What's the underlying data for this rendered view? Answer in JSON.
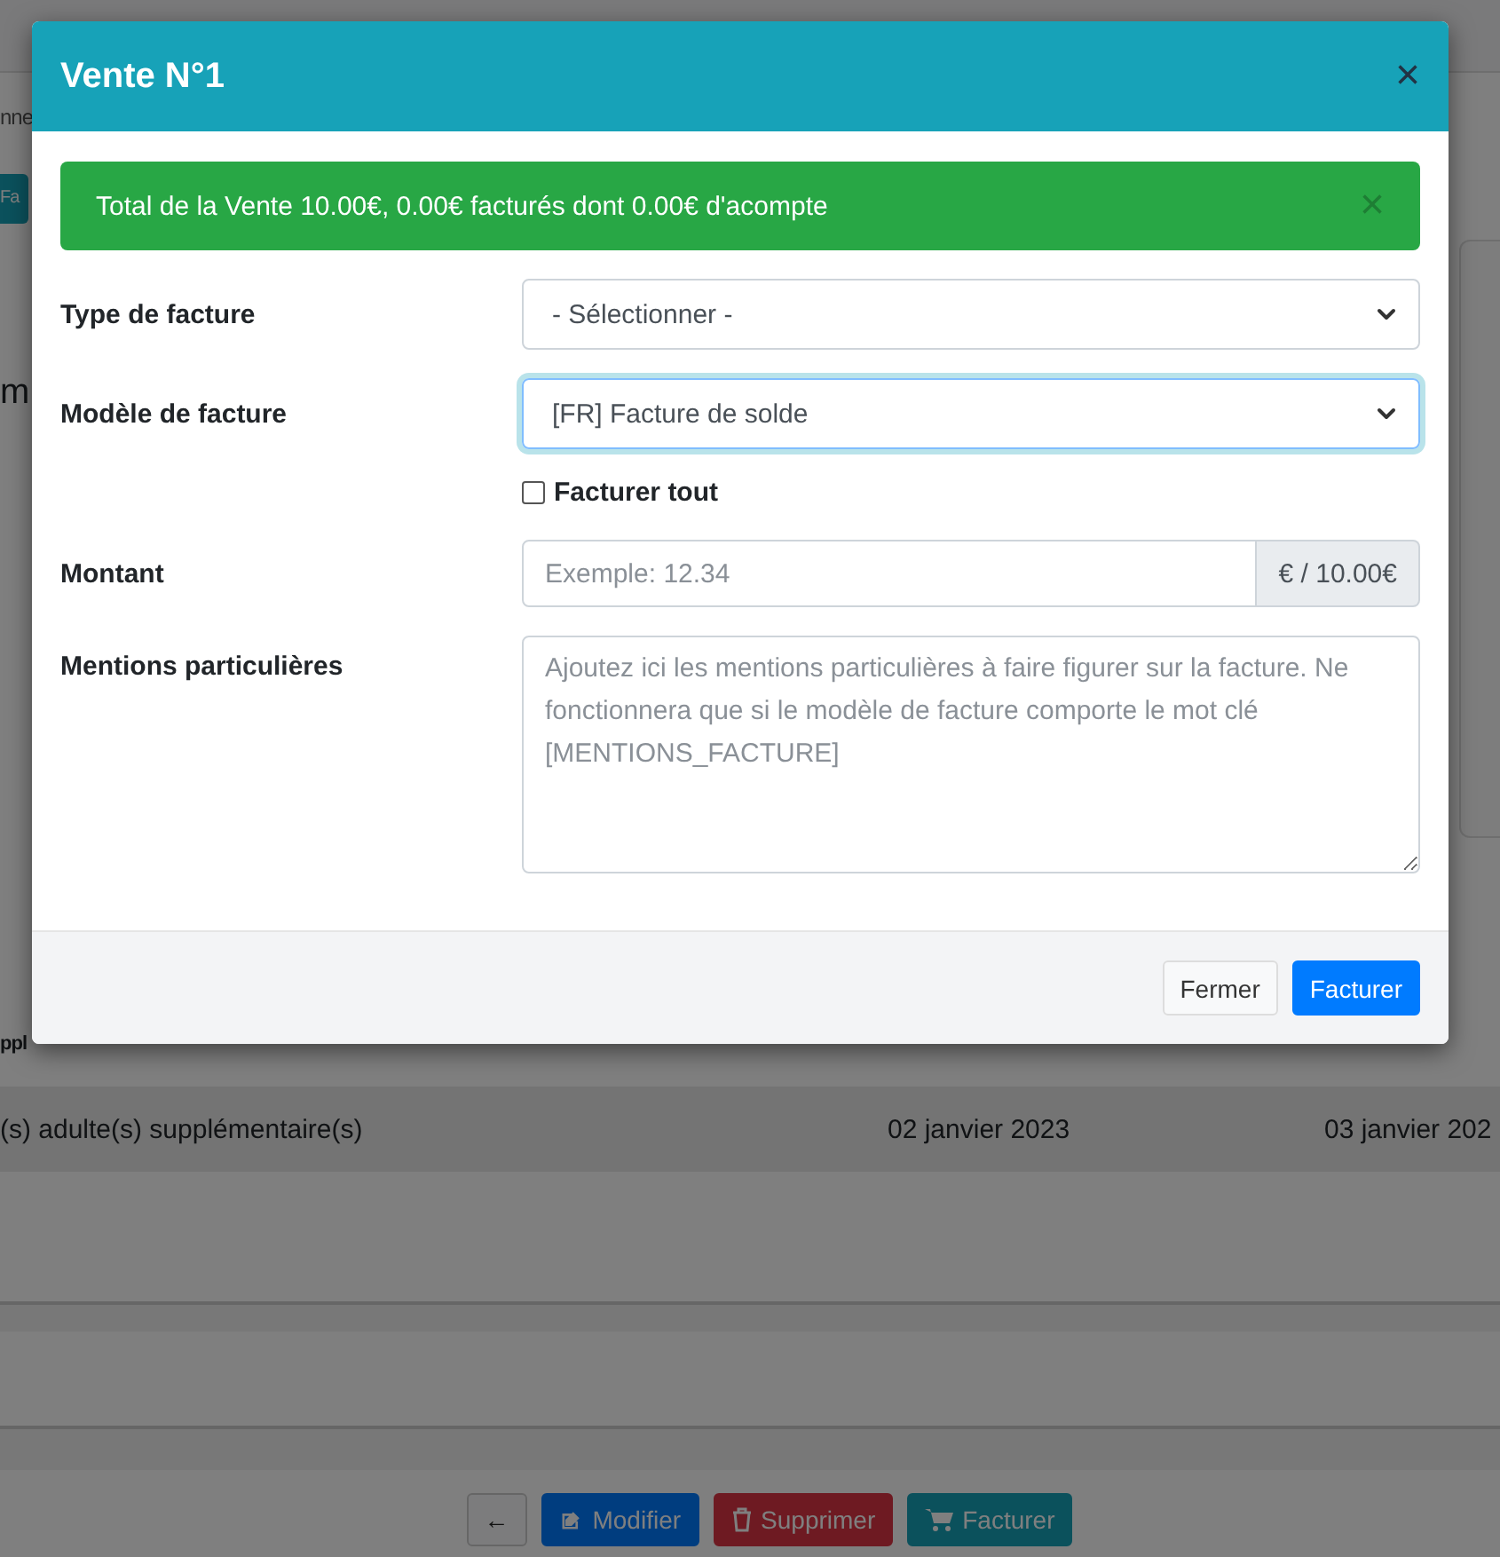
{
  "background": {
    "breadcrumb": "nne",
    "tab_button": "Fa",
    "heading": "m",
    "section_label": "ppl",
    "table_row": [
      "(s) adulte(s) supplémentaire(s)",
      "02 janvier 2023",
      "03 janvier 202"
    ],
    "actions": [
      {
        "kind": "back",
        "label": "←"
      },
      {
        "kind": "edit",
        "label": "Modifier"
      },
      {
        "kind": "delete",
        "label": "Supprimer"
      },
      {
        "kind": "invoice",
        "label": "Facturer"
      }
    ]
  },
  "modal": {
    "title": "Vente N°1",
    "close": "×",
    "alert": {
      "text": "Total de la Vente 10.00€, 0.00€ facturés dont 0.00€ d'acompte",
      "close": "×"
    },
    "fields": [
      {
        "kind": "select",
        "label": "Type de facture",
        "value": "- Sélectionner -",
        "focused": false
      },
      {
        "kind": "select",
        "label": "Modèle de facture",
        "value": "[FR] Facture de solde",
        "focused": true
      },
      {
        "kind": "checkbox",
        "label": "Facturer tout",
        "checked": false
      },
      {
        "kind": "amount",
        "label": "Montant",
        "placeholder": "Exemple: 12.34",
        "addon": "€ / 10.00€"
      },
      {
        "kind": "textarea",
        "label": "Mentions particulières",
        "placeholder": "Ajoutez ici les mentions particulières à faire figurer sur la facture. Ne fonctionnera que si le modèle de facture comporte le mot clé [MENTIONS_FACTURE]"
      }
    ],
    "buttons": [
      {
        "kind": "secondary",
        "label": "Fermer"
      },
      {
        "kind": "primary",
        "label": "Facturer"
      }
    ]
  }
}
